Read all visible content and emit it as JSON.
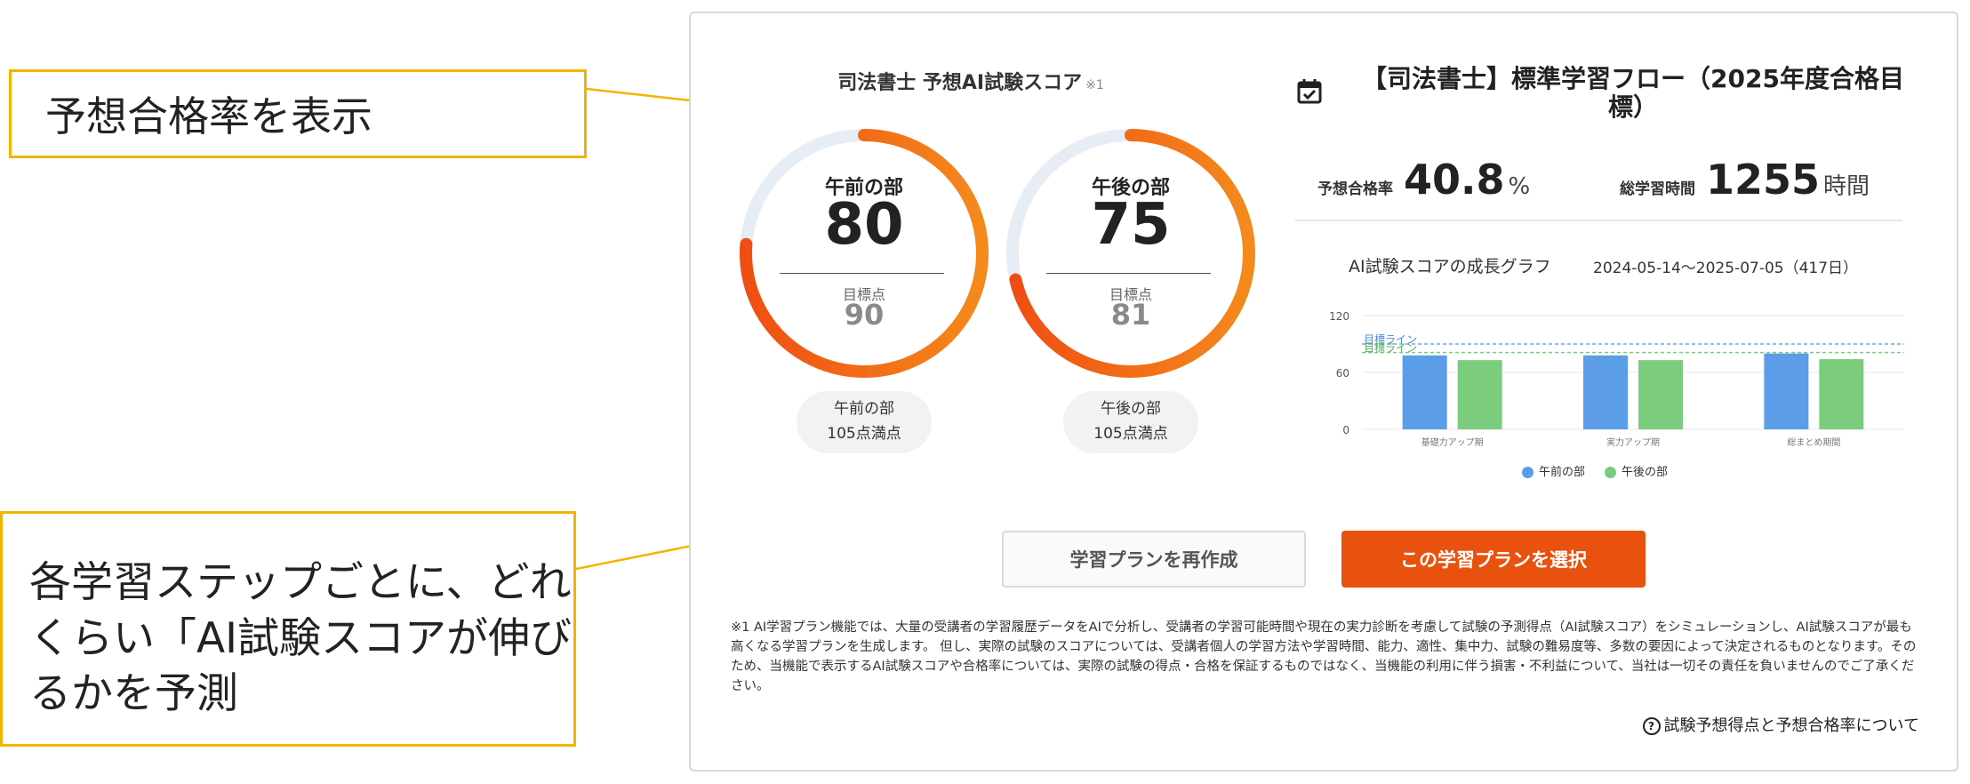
{
  "callouts": {
    "pass_rate": "予想合格率を表示",
    "score_growth": "各学習ステップごとに、どれくらい「AI試験スコアが伸びるかを予測"
  },
  "score": {
    "title": "司法書士 予想AI試験スコア",
    "note": "※1",
    "gauges": [
      {
        "name": "午前の部",
        "score": "80",
        "target_label": "目標点",
        "target": "90",
        "pill_line1": "午前の部",
        "pill_line2": "105点満点",
        "fill": 0.762
      },
      {
        "name": "午後の部",
        "score": "75",
        "target_label": "目標点",
        "target": "81",
        "pill_line1": "午後の部",
        "pill_line2": "105点満点",
        "fill": 0.714
      }
    ]
  },
  "flow": {
    "title": "【司法書士】標準学習フロー（2025年度合格目標）",
    "pass_rate_label": "予想合格率",
    "pass_rate_value": "40.8",
    "pass_rate_unit": "%",
    "hours_label": "総学習時間",
    "hours_value": "1255",
    "hours_unit": "時間"
  },
  "chart_data": {
    "type": "bar",
    "title": "AI試験スコアの成長グラフ",
    "date_range": "2024-05-14～2025-07-05（417日）",
    "categories": [
      "基礎力アップ期",
      "実力アップ期",
      "総まとめ期間"
    ],
    "yticks": [
      0,
      60,
      120
    ],
    "ylim": [
      0,
      120
    ],
    "target_label": "目標ライン",
    "target_lines": [
      90,
      81
    ],
    "series": [
      {
        "name": "午前の部",
        "color": "#5b9de6",
        "values": [
          78,
          78,
          80
        ]
      },
      {
        "name": "午後の部",
        "color": "#7ccc7e",
        "values": [
          73,
          73,
          74
        ]
      }
    ]
  },
  "buttons": {
    "recreate": "学習プランを再作成",
    "select": "この学習プランを選択"
  },
  "disclaimer": "※1 AI学習プラン機能では、大量の受講者の学習履歴データをAIで分析し、受講者の学習可能時間や現在の実力診断を考慮して試験の予測得点（AI試験スコア）をシミュレーションし、AI試験スコアが最も高くなる学習プランを生成します。 但し、実際の試験のスコアについては、受講者個人の学習方法や学習時間、能力、適性、集中力、試験の難易度等、多数の要因によって決定されるものとなります。そのため、当機能で表示するAI試験スコアや合格率については、実際の試験の得点・合格を保証するものではなく、当機能の利用に伴う損害・不利益について、当社は一切その責任を負いませんのでご了承ください。",
  "help_link": "試験予想得点と予想合格率について",
  "colors": {
    "accent": "#e8510e",
    "callout_border": "#f3b400",
    "gauge_track": "#e6edf4"
  }
}
